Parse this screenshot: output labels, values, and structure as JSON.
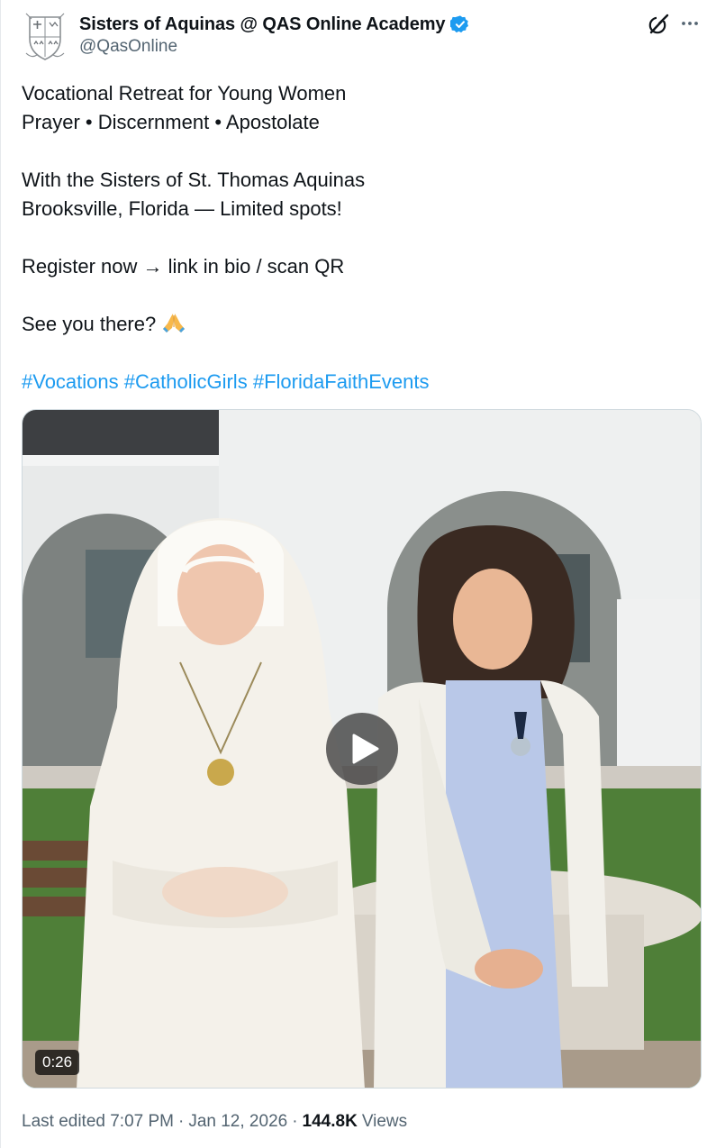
{
  "post": {
    "display_name": "Sisters of Aquinas @ QAS Online Academy",
    "handle": "@QasOnline",
    "verified_icon": "verified-badge-icon",
    "lines": [
      "Vocational Retreat for Young Women",
      "Prayer • Discernment • Apostolate",
      "",
      "With the Sisters of St. Thomas Aquinas",
      "Brooksville, Florida — Limited spots!",
      "",
      "Register now → link in bio / scan QR",
      "",
      "See you there? "
    ],
    "emoji": "🙏",
    "hashtags": [
      "#Vocations",
      "#CatholicGirls",
      "#FloridaFaithEvents"
    ]
  },
  "media": {
    "duration": "0:26",
    "play_icon": "play-icon"
  },
  "footer": {
    "edited_label": "Last edited 7:07 PM",
    "separator": "·",
    "date": "Jan 12, 2026",
    "views_count": "144.8K",
    "views_label": "Views"
  },
  "colors": {
    "link": "#1d9bf0",
    "text": "#0f1419",
    "secondary": "#536471",
    "verified": "#1d9bf0"
  }
}
